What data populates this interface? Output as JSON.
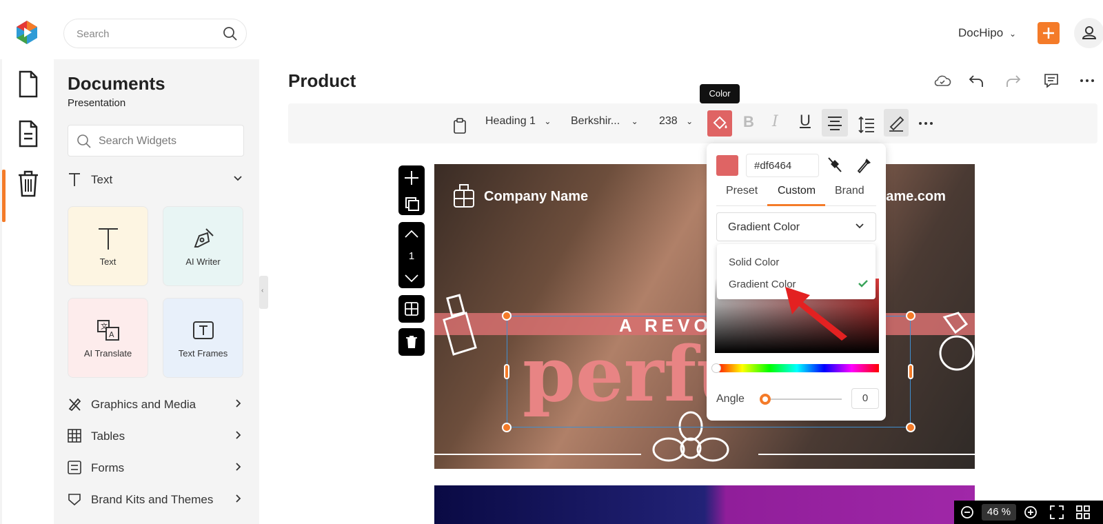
{
  "header": {
    "search_placeholder": "Search",
    "brand_label": "DocHipo"
  },
  "sidebar": {
    "title": "Documents",
    "subtitle": "Presentation",
    "widget_search_placeholder": "Search Widgets",
    "text_section": "Text",
    "tiles": [
      {
        "label": "Text"
      },
      {
        "label": "AI Writer"
      },
      {
        "label": "AI Translate"
      },
      {
        "label": "Text Frames"
      }
    ],
    "sections": [
      "Graphics and Media",
      "Tables",
      "Forms",
      "Brand Kits and Themes"
    ]
  },
  "editor": {
    "doc_title": "Product",
    "tooltip": "Color",
    "toolbar": {
      "style": "Heading 1",
      "font": "Berkshir...",
      "size": "238"
    }
  },
  "slide": {
    "company": "Company Name",
    "domain": "name.com",
    "tagline": "A REVOL",
    "headline": "perfu",
    "page_number": "1"
  },
  "color_popup": {
    "swatch_color": "#df6464",
    "hex_value": "#df6464",
    "tabs": [
      "Preset",
      "Custom",
      "Brand"
    ],
    "active_tab": "Custom",
    "mode_selected": "Gradient Color",
    "options": [
      "Solid Color",
      "Gradient Color"
    ],
    "angle_label": "Angle",
    "angle_value": "0"
  },
  "zoom": {
    "value": "46 %"
  },
  "colors": {
    "accent": "#f47b29",
    "selection": "#3f8fd0"
  }
}
